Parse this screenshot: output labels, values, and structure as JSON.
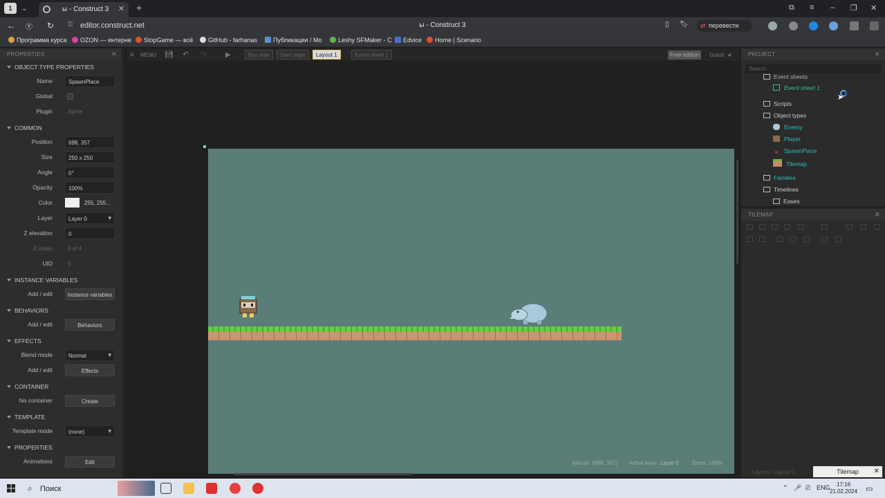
{
  "browser": {
    "tab_count": "1",
    "tab_title": "ы - Construct 3",
    "window_title": "ы - Construct 3",
    "url": "editor.construct.net",
    "translate_label": "перевести",
    "bookmarks": [
      "Программа курса",
      "OZON — интерне",
      "StopGame — всё",
      "GitHub - farhanas",
      "Публикации / Mo",
      "Leshy SFMaker - C",
      "Edvice",
      "Home | Scenario"
    ]
  },
  "toolbar": {
    "menu_label": "MENU",
    "tabs": [
      "Buy now",
      "Start page",
      "Layout 1",
      "Event sheet 1"
    ],
    "free_edition": "Free edition",
    "guest": "Guest"
  },
  "properties": {
    "panel_title": "PROPERTIES",
    "sections": {
      "object_type": "OBJECT TYPE PROPERTIES",
      "common": "COMMON",
      "instance_vars": "INSTANCE VARIABLES",
      "behaviors": "BEHAVIORS",
      "effects": "EFFECTS",
      "container": "CONTAINER",
      "template": "TEMPLATE",
      "props": "PROPERTIES"
    },
    "labels": {
      "name": "Name",
      "global": "Global",
      "plugin": "Plugin",
      "position": "Position",
      "size": "Size",
      "angle": "Angle",
      "opacity": "Opacity",
      "color": "Color",
      "layer": "Layer",
      "z_elevation": "Z elevation",
      "z_index": "Z index",
      "uid": "UID",
      "add_edit": "Add / edit",
      "blend_mode": "Blend mode",
      "no_container": "No container",
      "template_mode": "Template mode",
      "animations": "Animations"
    },
    "values": {
      "name": "SpawnPlace",
      "plugin": "Sprite",
      "position": "698, 357",
      "size": "250 x 250",
      "angle": "0°",
      "opacity": "100%",
      "color": "255, 255...",
      "layer": "Layer 0",
      "z_elevation": "0",
      "z_index": "3 of 4",
      "uid": "5",
      "instance_variables_btn": "Instance variables",
      "behaviors_btn": "Behaviors",
      "blend_mode": "Normal",
      "effects_btn": "Effects",
      "create_btn": "Create",
      "template_mode": "(none)",
      "edit_btn": "Edit"
    }
  },
  "status": {
    "mouse": "Mouse: (698, 357)",
    "active_layer_label": "Active layer:",
    "active_layer": "Layer 0",
    "zoom": "Zoom: 100%"
  },
  "project": {
    "panel_title": "PROJECT",
    "search_placeholder": "Search",
    "items": {
      "event_sheets": "Event sheets",
      "event_sheet_1": "Event sheet 1",
      "scripts": "Scripts",
      "object_types": "Object types",
      "enemy": "Enemy",
      "player": "Player",
      "spawnplace": "SpawnPlace",
      "tilemap": "Tilemap",
      "families": "Families",
      "timelines": "Timelines",
      "eases": "Eases"
    }
  },
  "tilemap_panel": {
    "title": "TILEMAP",
    "layers_tab": "Layers - Layout 1",
    "tilemap_tab": "Tilemap"
  },
  "taskbar": {
    "search": "Поиск",
    "lang": "ENG",
    "time": "17:16",
    "date": "21.02.2024"
  },
  "colors": {
    "scene_bg": "#5a7d77",
    "accent_link": "#3fbf7f",
    "active_tab_border": "#e5c55c"
  }
}
